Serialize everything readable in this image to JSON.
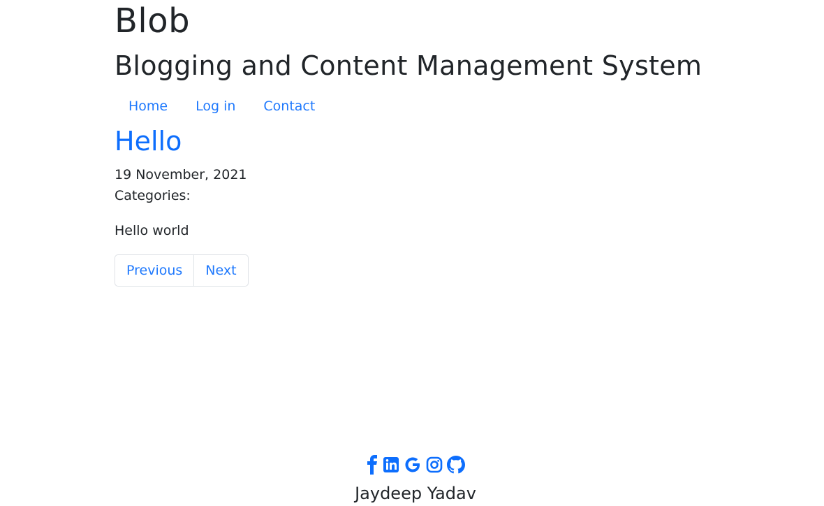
{
  "site": {
    "title": "Blob",
    "subtitle": "Blogging and Content Management System"
  },
  "nav": {
    "items": [
      {
        "label": "Home"
      },
      {
        "label": "Log in"
      },
      {
        "label": "Contact"
      }
    ]
  },
  "post": {
    "title": "Hello",
    "date": "19 November, 2021",
    "categories_label": "Categories:",
    "body": "Hello world"
  },
  "pagination": {
    "previous_label": "Previous",
    "next_label": "Next"
  },
  "footer": {
    "social_icons": [
      "facebook-icon",
      "linkedin-icon",
      "google-icon",
      "instagram-icon",
      "github-icon"
    ],
    "name": "Jaydeep Yadav"
  },
  "colors": {
    "link": "#0d6efd",
    "text": "#212529",
    "border": "#dee2e6"
  }
}
